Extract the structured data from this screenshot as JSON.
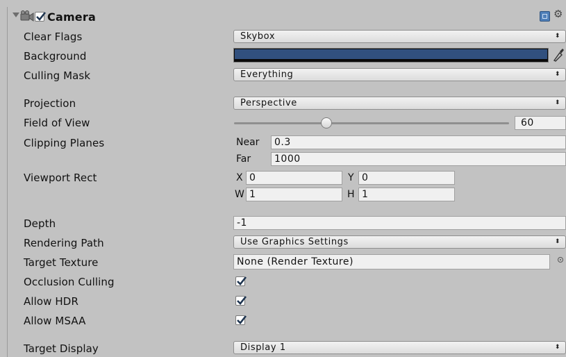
{
  "component": {
    "title": "Camera",
    "enabled": true
  },
  "fields": {
    "clear_flags": {
      "label": "Clear Flags",
      "value": "Skybox"
    },
    "background": {
      "label": "Background",
      "color": "#31507e"
    },
    "culling_mask": {
      "label": "Culling Mask",
      "value": "Everything"
    },
    "projection": {
      "label": "Projection",
      "value": "Perspective"
    },
    "field_of_view": {
      "label": "Field of View",
      "value": "60",
      "slider_fraction": 0.33
    },
    "clipping_planes": {
      "label": "Clipping Planes",
      "near_label": "Near",
      "near_value": "0.3",
      "far_label": "Far",
      "far_value": "1000"
    },
    "viewport_rect": {
      "label": "Viewport Rect",
      "x_label": "X",
      "x_value": "0",
      "y_label": "Y",
      "y_value": "0",
      "w_label": "W",
      "w_value": "1",
      "h_label": "H",
      "h_value": "1"
    },
    "depth": {
      "label": "Depth",
      "value": "-1"
    },
    "rendering_path": {
      "label": "Rendering Path",
      "value": "Use Graphics Settings"
    },
    "target_texture": {
      "label": "Target Texture",
      "value": "None (Render Texture)"
    },
    "occlusion_culling": {
      "label": "Occlusion Culling",
      "checked": true
    },
    "allow_hdr": {
      "label": "Allow HDR",
      "checked": true
    },
    "allow_msaa": {
      "label": "Allow MSAA",
      "checked": true
    },
    "target_display": {
      "label": "Target Display",
      "value": "Display 1"
    }
  },
  "icons": {
    "foldout": "triangle-down-icon",
    "camera": "camera-icon",
    "help": "help-book-icon",
    "settings": "gear-icon",
    "eyedropper": "eyedropper-icon",
    "object_picker": "object-picker-icon",
    "dropdown_arrow": "updown-arrow-icon"
  },
  "colors": {
    "panel_bg": "#c2c2c2",
    "check_color": "#1f3550"
  }
}
